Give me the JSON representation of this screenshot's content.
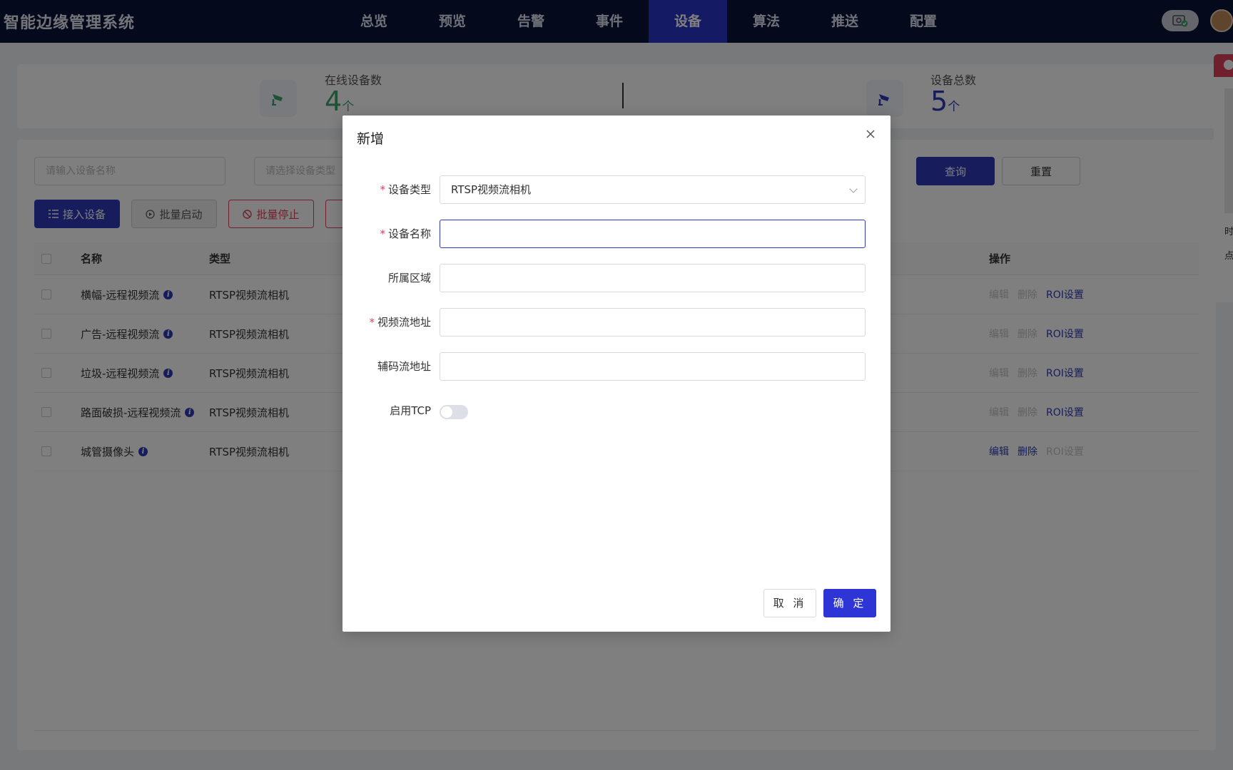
{
  "app": {
    "title": "智能边缘管理系统"
  },
  "nav": {
    "items": [
      {
        "label": "总览"
      },
      {
        "label": "预览"
      },
      {
        "label": "告警"
      },
      {
        "label": "事件"
      },
      {
        "label": "设备"
      },
      {
        "label": "算法"
      },
      {
        "label": "推送"
      },
      {
        "label": "配置"
      }
    ],
    "active": "设备"
  },
  "stats": {
    "online": {
      "label": "在线设备数",
      "value": "4",
      "unit": "个",
      "color": "#3aa56b"
    },
    "total": {
      "label": "设备总数",
      "value": "5",
      "unit": "个",
      "color": "#2f3ab8"
    }
  },
  "filters": {
    "name_placeholder": "请输入设备名称",
    "type_placeholder": "请选择设备类型",
    "query_label": "查询",
    "reset_label": "重置"
  },
  "toolbar": {
    "add_label": "接入设备",
    "batch_start_label": "批量启动",
    "batch_stop_label": "批量停止"
  },
  "table": {
    "columns": {
      "name": "名称",
      "type": "类型",
      "ops": "操作"
    },
    "rows": [
      {
        "name": "横幅-远程视频流",
        "type": "RTSP视频流相机",
        "edit": "编辑",
        "delete": "删除",
        "roi": "ROI设置"
      },
      {
        "name": "广告-远程视频流",
        "type": "RTSP视频流相机",
        "edit": "编辑",
        "delete": "删除",
        "roi": "ROI设置"
      },
      {
        "name": "垃圾-远程视频流",
        "type": "RTSP视频流相机",
        "edit": "编辑",
        "delete": "删除",
        "roi": "ROI设置"
      },
      {
        "name": "路面破损-远程视频流",
        "type": "RTSP视频流相机",
        "edit": "编辑",
        "delete": "删除",
        "roi": "ROI设置"
      },
      {
        "name": "城管摄像头",
        "type": "RTSP视频流相机",
        "edit": "编辑",
        "delete": "删除",
        "roi": "ROI设置"
      }
    ]
  },
  "side_panel": {
    "line1": "时",
    "line2": "点"
  },
  "modal": {
    "title": "新增",
    "fields": {
      "device_type": {
        "label": "设备类型",
        "value": "RTSP视频流相机",
        "required": true
      },
      "device_name": {
        "label": "设备名称",
        "value": "",
        "required": true
      },
      "area": {
        "label": "所属区域",
        "value": "",
        "required": false
      },
      "stream_url": {
        "label": "视频流地址",
        "value": "",
        "required": true
      },
      "sub_stream_url": {
        "label": "辅码流地址",
        "value": "",
        "required": false
      },
      "tcp": {
        "label": "启用TCP",
        "enabled": false
      }
    },
    "cancel_label": "取 消",
    "ok_label": "确 定",
    "required_mark": "*"
  },
  "colors": {
    "nav_bg": "#0b1238",
    "accent": "#2f3ab8",
    "danger": "#e0405a"
  }
}
